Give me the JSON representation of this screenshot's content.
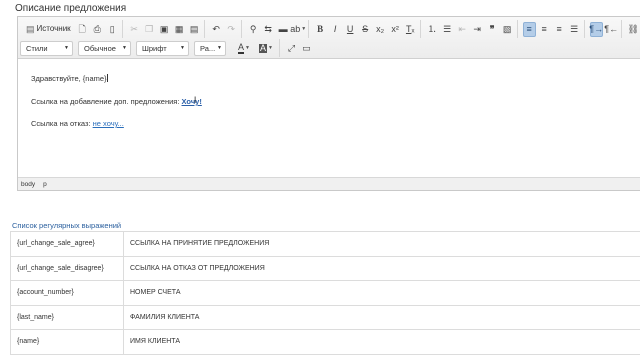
{
  "section": {
    "title": "Описание предложения"
  },
  "toolbar": {
    "source_label": "Источник",
    "styles_combo": "Стили",
    "format_combo": "Обычное",
    "font_combo": "Шрифт",
    "size_combo": "Ра..."
  },
  "content": {
    "line1": "Здравствуйте, {name}",
    "line2_text": "Ссылка на добавление доп. предложения: ",
    "line2_link": "Хочу!",
    "line3_text": "Ссылка на отказ: ",
    "line3_link": "не хочу..."
  },
  "pathbar": {
    "items": [
      "body",
      "p"
    ]
  },
  "regex": {
    "title": "Список регулярных выражений",
    "rows": [
      {
        "key": "{url_change_sale_agree}",
        "desc": "ССЫЛКА НА ПРИНЯТИЕ ПРЕДЛОЖЕНИЯ"
      },
      {
        "key": "{url_change_sale_disagree}",
        "desc": "ССЫЛКА НА ОТКАЗ ОТ ПРЕДЛОЖЕНИЯ"
      },
      {
        "key": "{account_number}",
        "desc": "НОМЕР СЧЕТА"
      },
      {
        "key": "{last_name}",
        "desc": "ФАМИЛИЯ КЛИЕНТА"
      },
      {
        "key": "{name}",
        "desc": "ИМЯ КЛИЕНТА"
      }
    ]
  }
}
